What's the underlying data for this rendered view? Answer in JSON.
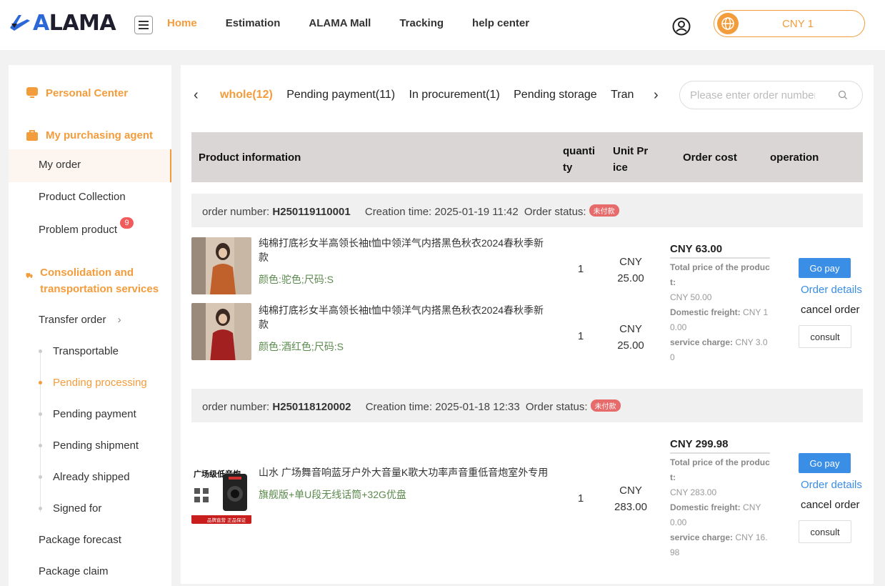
{
  "header": {
    "logo_text": "ALAMA",
    "nav": [
      "Home",
      "Estimation",
      "ALAMA Mall",
      "Tracking",
      "help center"
    ],
    "currency": "CNY 1"
  },
  "sidebar": {
    "personal_center": "Personal Center",
    "purchasing_agent": "My purchasing agent",
    "my_order": "My order",
    "product_collection": "Product Collection",
    "problem_product": "Problem product",
    "problem_badge": "9",
    "consolidation": "Consolidation and transportation services",
    "transfer_order": "Transfer order",
    "sub_items": [
      "Transportable",
      "Pending processing",
      "Pending payment",
      "Pending shipment",
      "Already shipped",
      "Signed for"
    ],
    "package_forecast": "Package forecast",
    "package_claim": "Package claim"
  },
  "tabs": [
    "whole(12)",
    "Pending payment(11)",
    "In procurement(1)",
    "Pending storage",
    "Tran"
  ],
  "search": {
    "placeholder": "Please enter order number"
  },
  "table_headers": {
    "product": "Product information",
    "quantity": "quanti ty",
    "unit_price": "Unit Pr ice",
    "order_cost": "Order cost",
    "operation": "operation"
  },
  "labels": {
    "order_number": "order number: ",
    "creation_time": "Creation time: ",
    "order_status": "Order status:",
    "total_product": "Total price of the product:",
    "domestic_freight": "Domestic freight:",
    "service_charge": "service charge:",
    "go_pay": "Go pay",
    "order_details": "Order details",
    "cancel_order": "cancel order",
    "consult": "consult"
  },
  "orders": [
    {
      "number": "H250119110001",
      "time": "2025-01-19 11:42",
      "status": "未付款",
      "total": "CNY 63.00",
      "product_price": "CNY 50.00",
      "freight": "CNY 10.00",
      "service": "CNY 3.00",
      "items": [
        {
          "title": "纯棉打底衫女半高领长袖t恤中领洋气内搭黑色秋衣2024春秋季新款",
          "spec": "颜色:驼色;尺码:S",
          "qty": "1",
          "price": "CNY 25.00",
          "color": "#c0602a"
        },
        {
          "title": "纯棉打底衫女半高领长袖t恤中领洋气内搭黑色秋衣2024春秋季新款",
          "spec": "颜色:酒红色;尺码:S",
          "qty": "1",
          "price": "CNY 25.00",
          "color": "#a32020"
        }
      ]
    },
    {
      "number": "H250118120002",
      "time": "2025-01-18 12:33",
      "status": "未付款",
      "total": "CNY 299.98",
      "product_price": "CNY 283.00",
      "freight": "CNY 0.00",
      "service": "CNY 16.98",
      "items": [
        {
          "title": "山水 广场舞音响蓝牙户外大音量K歌大功率声音重低音炮室外专用",
          "spec": "旗舰版+单U段无线话筒+32G优盘",
          "qty": "1",
          "price": "CNY 283.00",
          "img_text": "广场级低音炮",
          "img_bar": "品牌直营 正品保证"
        }
      ]
    }
  ]
}
